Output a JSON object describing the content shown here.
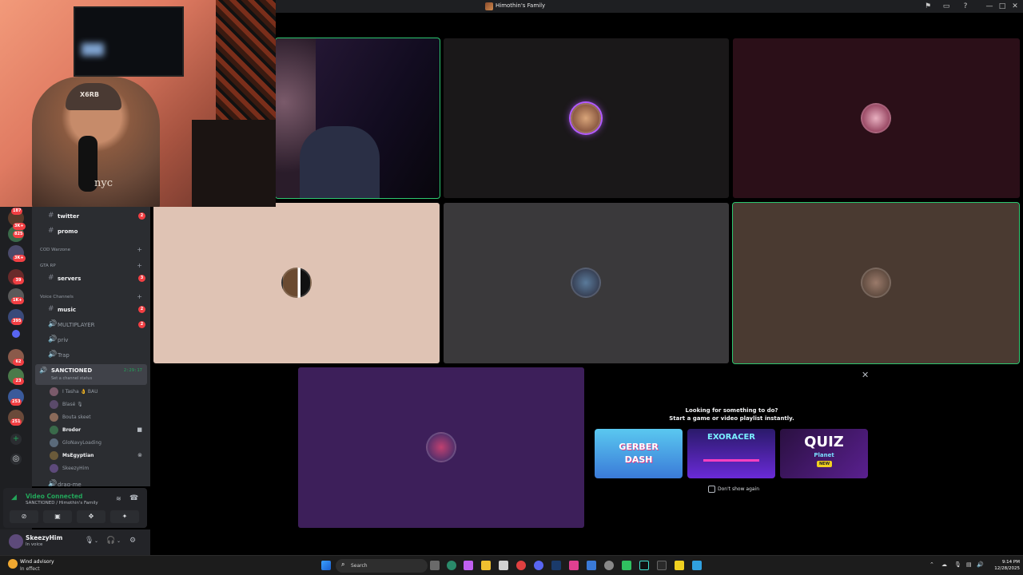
{
  "window": {
    "title": "Himothin's Family",
    "controls": {
      "minimize": "—",
      "maximize": "□",
      "close": "✕"
    }
  },
  "webcam": {
    "cap_text": "X6RB",
    "shirt_text": "nyc"
  },
  "server_rail": {
    "badges": [
      "187",
      "3K+",
      "825",
      "3K+",
      "39",
      "1K+",
      "395",
      "62",
      "23",
      "253",
      "251"
    ]
  },
  "channels": {
    "text": [
      {
        "name": "twitter",
        "count": "2"
      },
      {
        "name": "promo",
        "count": ""
      }
    ],
    "categories": {
      "cod": "COD Warzone",
      "gta": "GTA RP",
      "voice": "Voice Channels"
    },
    "servers": {
      "name": "servers",
      "count": "3"
    },
    "voice": [
      {
        "name": "music",
        "count": "2"
      },
      {
        "name": "MULTIPLAYER",
        "count": "2"
      },
      {
        "name": "priv",
        "count": ""
      },
      {
        "name": "Trap",
        "count": ""
      }
    ],
    "active": {
      "name": "SANCTIONED",
      "timer": "2:29:17",
      "status_placeholder": "Set a channel status"
    },
    "members": [
      {
        "name": "I Tasha 👌 BAU",
        "bright": false
      },
      {
        "name": "Blasé 🎙",
        "bright": false
      },
      {
        "name": "Bouta skeet",
        "bright": false
      },
      {
        "name": "Brodor",
        "bright": true
      },
      {
        "name": "GloNavyLoading",
        "bright": false
      },
      {
        "name": "MsEgyptian",
        "bright": true
      },
      {
        "name": "SkeezyHim",
        "bright": false
      }
    ],
    "cutoff": {
      "name": "drag-me"
    }
  },
  "voice_panel": {
    "title": "Video Connected",
    "subtitle": "SANCTIONED / Himothin's Family"
  },
  "user_bar": {
    "name": "SkeezyHim",
    "status": "In voice"
  },
  "activity": {
    "heading1": "Looking for something to do?",
    "heading2": "Start a game or video playlist instantly.",
    "games": [
      {
        "title": "GERBER",
        "subtitle": "DASH"
      },
      {
        "title": "EXORACER",
        "subtitle": ""
      },
      {
        "title": "QUIZ",
        "subtitle": "Planet",
        "tag": "NEW"
      }
    ],
    "dont_show": "Don't show again"
  },
  "taskbar": {
    "weather_title": "Wind advisory",
    "weather_sub": "In effect",
    "search": "Search",
    "time": "9:14 PM",
    "date": "12/28/2025"
  },
  "colors": {
    "speaking": "#2dc770",
    "danger": "#f23f43",
    "discord_bg": "#2b2d31"
  }
}
